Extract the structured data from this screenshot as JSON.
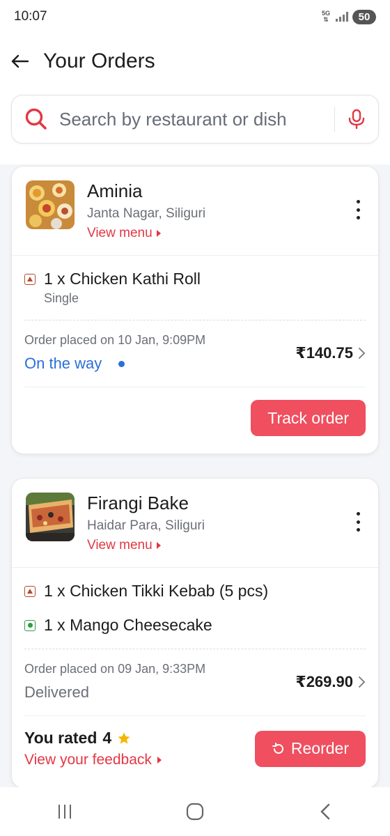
{
  "status_bar": {
    "time": "10:07",
    "network": "5G",
    "battery": "50"
  },
  "header": {
    "title": "Your Orders"
  },
  "search": {
    "placeholder": "Search by restaurant or dish"
  },
  "orders": [
    {
      "restaurant": "Aminia",
      "location": "Janta Nagar, Siliguri",
      "view_menu": "View menu",
      "items": [
        {
          "text": "1 x Chicken Kathi Roll",
          "diet": "non-veg",
          "sub": "Single"
        }
      ],
      "placed": "Order placed on 10 Jan, 9:09PM",
      "status": "On the way",
      "price": "₹140.75",
      "action": "Track order"
    },
    {
      "restaurant": "Firangi Bake",
      "location": "Haidar Para, Siliguri",
      "view_menu": "View menu",
      "items": [
        {
          "text": "1 x Chicken Tikki Kebab (5 pcs)",
          "diet": "non-veg"
        },
        {
          "text": "1 x Mango Cheesecake",
          "diet": "veg"
        }
      ],
      "placed": "Order placed on 09 Jan, 9:33PM",
      "status": "Delivered",
      "price": "₹269.90",
      "rated_label": "You rated",
      "rating": "4",
      "feedback": "View your feedback",
      "action": "Reorder"
    }
  ],
  "colors": {
    "accent": "#ef4f5f",
    "link": "#e23744",
    "on_the_way": "#2a6fd8"
  }
}
